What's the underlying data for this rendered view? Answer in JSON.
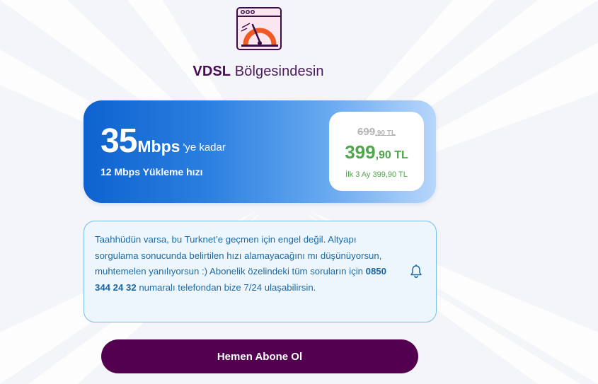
{
  "region": {
    "highlight": "VDSL",
    "rest": " Bölgesindesin"
  },
  "speed": {
    "download_value": "35",
    "download_unit": "Mbps",
    "download_suffix": "'ye kadar",
    "upload_text": "12 Mbps Yükleme hızı"
  },
  "price": {
    "old_int": "699",
    "old_dec": ",90 TL",
    "new_int": "399",
    "new_dec": ",90 TL",
    "promo": "İlk 3 Ay 399,90 TL"
  },
  "info": {
    "text_before": "Taahhüdün varsa, bu Turknet’e geçmen için engel değil. Altyapı sorgulama sonucunda belirtilen hızı alamayacağını mı düşünüyorsun, muhtemelen yanılıyorsun :) Abonelik özelindeki tüm soruların için ",
    "phone": "0850 344 24 32",
    "text_after": " numaralı telefondan bize 7/24 ulaşabilirsin."
  },
  "cta": {
    "label": "Hemen Abone Ol"
  },
  "colors": {
    "brand_purple": "#52004f",
    "card_blue": "#0d62cf",
    "price_green": "#4fa64b",
    "info_blue": "#1c6aa6"
  },
  "icons": {
    "hero": "speedometer-browser-icon",
    "info": "bell-icon"
  }
}
